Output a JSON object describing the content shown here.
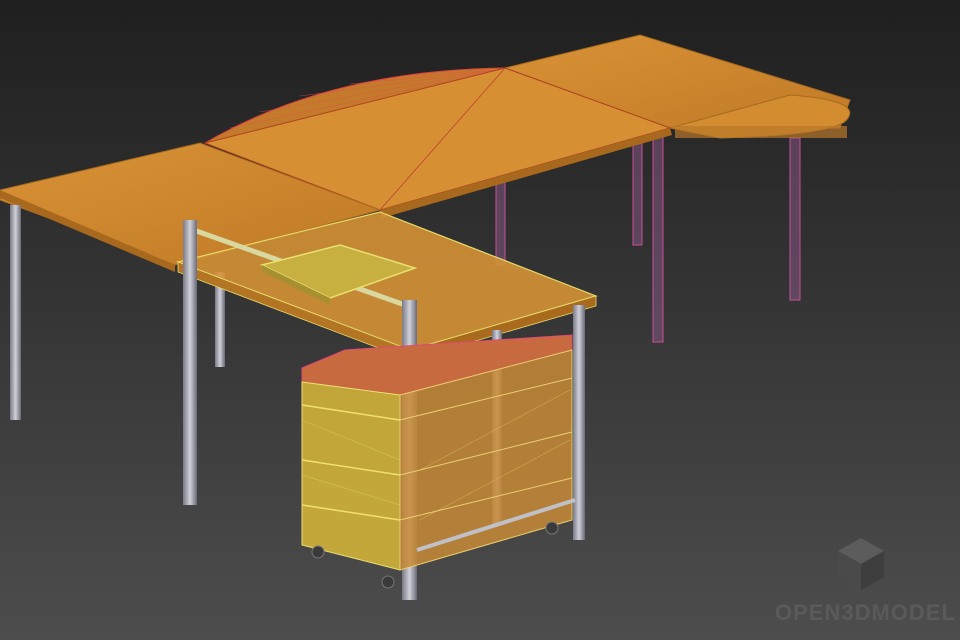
{
  "scene": {
    "subject": "3d-wireframe-office-desk-render",
    "colors": {
      "background_top": "#232323",
      "background_bottom": "#4a4a4a",
      "desk_top": "#d08a2e",
      "desk_top_light": "#e59a3a",
      "desk_edge": "#a86a20",
      "leg": "#9a9aa8",
      "leg_highlight": "#d8d8e0",
      "pink_wire": "#d04a9a",
      "yellow_wire": "#e8e070",
      "drawer": "#c98a38",
      "drawer_yellow": "#d8b840"
    }
  },
  "watermark": {
    "text": "OPEN3DMODEL",
    "icon": "cube-icon",
    "color": "#5a5a5a"
  }
}
